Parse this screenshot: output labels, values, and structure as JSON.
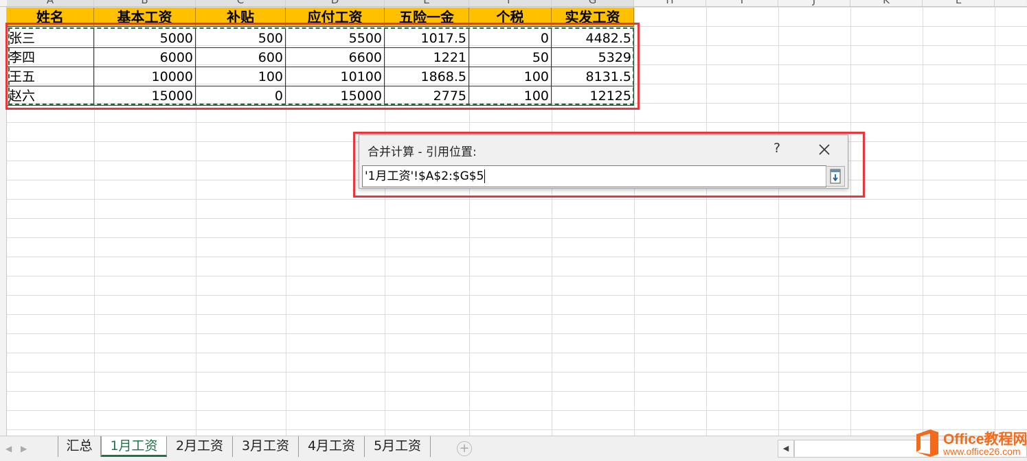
{
  "columns": [
    "A",
    "B",
    "C",
    "D",
    "E",
    "F",
    "G",
    "H",
    "I",
    "J",
    "K",
    "L",
    "M"
  ],
  "table": {
    "headers": [
      "姓名",
      "基本工资",
      "补贴",
      "应付工资",
      "五险一金",
      "个税",
      "实发工资"
    ],
    "rows": [
      [
        "张三",
        "5000",
        "500",
        "5500",
        "1017.5",
        "0",
        "4482.5"
      ],
      [
        "李四",
        "6000",
        "600",
        "6600",
        "1221",
        "50",
        "5329"
      ],
      [
        "王五",
        "10000",
        "100",
        "10100",
        "1868.5",
        "100",
        "8131.5"
      ],
      [
        "赵六",
        "15000",
        "0",
        "15000",
        "2775",
        "100",
        "12125"
      ]
    ]
  },
  "dialog": {
    "title": "合并计算 - 引用位置:",
    "help": "?",
    "reference": "'1月工资'!$A$2:$G$5"
  },
  "sheet_tabs": [
    "汇总",
    "1月工资",
    "2月工资",
    "3月工资",
    "4月工资",
    "5月工资"
  ],
  "active_tab": "1月工资",
  "add_sheet": "+",
  "watermark": {
    "title": "Office教程网",
    "url": "www.office26.com"
  },
  "colors": {
    "header_fill": "#ffc000",
    "highlight": "#e8383d",
    "excel_green": "#217346",
    "watermark": "#f26b1d"
  }
}
